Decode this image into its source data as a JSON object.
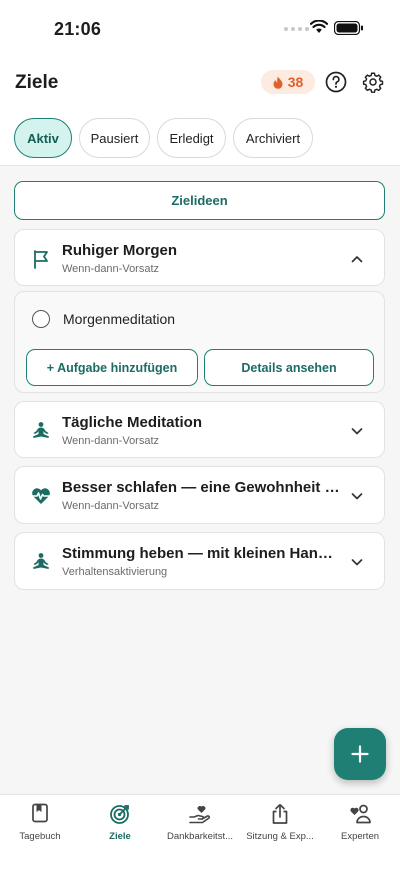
{
  "status": {
    "time": "21:06"
  },
  "header": {
    "title": "Ziele",
    "streak_count": "38"
  },
  "filter_tabs": [
    {
      "label": "Aktiv",
      "active": true
    },
    {
      "label": "Pausiert",
      "active": false
    },
    {
      "label": "Erledigt",
      "active": false
    },
    {
      "label": "Archiviert",
      "active": false
    }
  ],
  "ideas_button": "Zielideen",
  "goals": [
    {
      "title": "Ruhiger Morgen",
      "subtitle": "Wenn-dann-Vorsatz",
      "icon": "flag-icon",
      "expanded": true
    },
    {
      "title": "Tägliche Meditation",
      "subtitle": "Wenn-dann-Vorsatz",
      "icon": "meditation-icon",
      "expanded": false
    },
    {
      "title": "Besser schlafen — eine Gewohnheit n...",
      "subtitle": "Wenn-dann-Vorsatz",
      "icon": "heartbeat-icon",
      "expanded": false
    },
    {
      "title": "Stimmung heben — mit kleinen Handl...",
      "subtitle": "Verhaltensaktivierung",
      "icon": "meditation-icon",
      "expanded": false
    }
  ],
  "expanded_goal": {
    "task": "Morgenmeditation",
    "add_task_label": "+ Aufgabe hinzufügen",
    "details_label": "Details ansehen"
  },
  "bottom_nav": [
    {
      "label": "Tagebuch",
      "icon": "journal-icon",
      "active": false
    },
    {
      "label": "Ziele",
      "icon": "target-icon",
      "active": true
    },
    {
      "label": "Dankbarkeitst...",
      "icon": "gratitude-hand-icon",
      "active": false
    },
    {
      "label": "Sitzung & Exp...",
      "icon": "share-icon",
      "active": false
    },
    {
      "label": "Experten",
      "icon": "experts-icon",
      "active": false
    }
  ],
  "colors": {
    "accent": "#1f7f75",
    "accent_light": "#d5f3ee",
    "streak": "#e0622b",
    "streak_bg": "#fdebe1"
  }
}
